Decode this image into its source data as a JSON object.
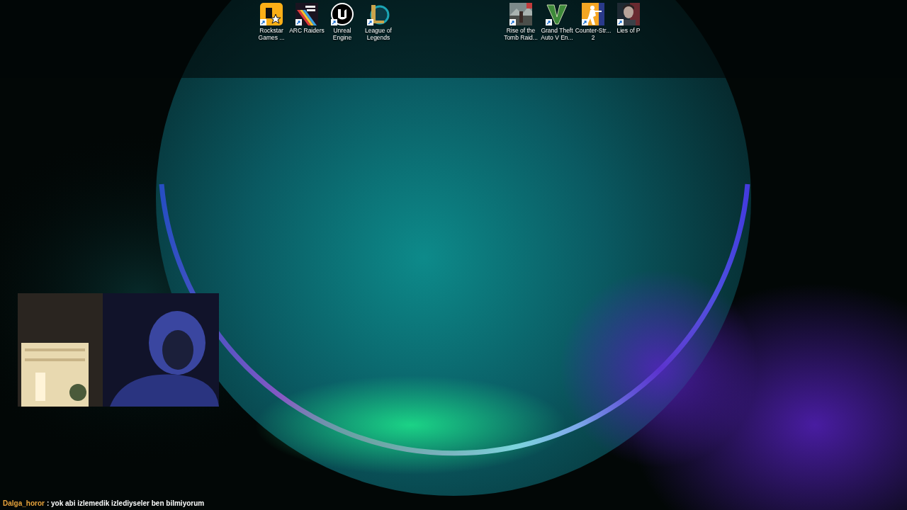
{
  "desktop_icons": [
    {
      "kind": "rockstar",
      "lines": [
        "Rockstar",
        "Games ..."
      ]
    },
    {
      "kind": "arc",
      "lines": [
        "ARC Raiders"
      ]
    },
    {
      "kind": "unreal",
      "lines": [
        "Unreal",
        "Engine"
      ]
    },
    {
      "kind": "league",
      "lines": [
        "League of",
        "Legends"
      ]
    },
    {
      "kind": "cover_ruins",
      "lines": [
        "Rise of the",
        "Tomb Raid..."
      ]
    },
    {
      "kind": "chevron",
      "lines": [
        "Grand Theft",
        "Auto V En..."
      ]
    },
    {
      "kind": "soldier",
      "lines": [
        "Counter-Str...",
        "2"
      ]
    },
    {
      "kind": "cover_portrait",
      "lines": [
        "Lies of P"
      ]
    }
  ],
  "chat": {
    "username": "Dalga_horor",
    "message": ": yok abi izlemedik izlediyseler ben bilmiyorum"
  }
}
